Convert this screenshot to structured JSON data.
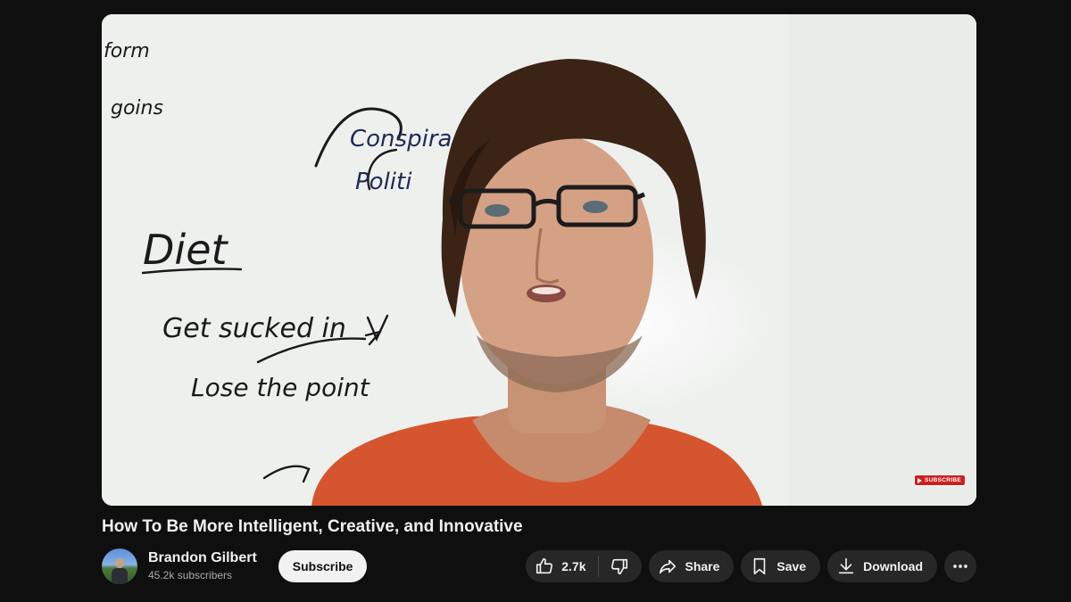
{
  "video": {
    "title": "How To Be More Intelligent, Creative, and Innovative",
    "watermark": "SUBSCRIBE",
    "whiteboard": {
      "words": [
        "form",
        "goins",
        "Conspirac",
        "Politi",
        "Diet",
        "Get sucked in",
        "Lose the point"
      ]
    }
  },
  "channel": {
    "name": "Brandon Gilbert",
    "subscribers": "45.2k subscribers",
    "subscribe_label": "Subscribe"
  },
  "actions": {
    "like_count": "2.7k",
    "share_label": "Share",
    "save_label": "Save",
    "download_label": "Download",
    "icons": [
      "thumbs-up-icon",
      "thumbs-down-icon",
      "share-arrow-icon",
      "bookmark-icon",
      "download-icon",
      "more-icon"
    ]
  },
  "colors": {
    "background": "#0f0f0f",
    "pill": "#272727",
    "subscribe_button": "#f1f1f1",
    "shirt": "#d4552e"
  }
}
